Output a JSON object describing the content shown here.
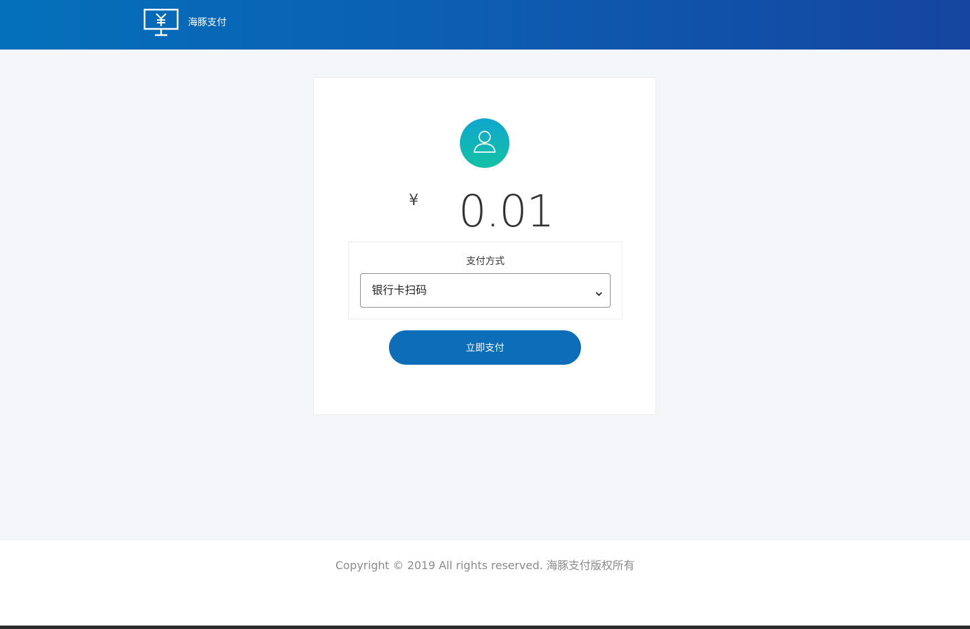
{
  "header": {
    "brand_icon": "monitor-yen-icon",
    "brand_name": "海豚支付",
    "gradient_start": "#0470ba",
    "gradient_end": "#1545a0"
  },
  "payment": {
    "avatar_icon": "user-icon",
    "currency_symbol": "¥",
    "amount": "0.01",
    "method_label": "支付方式",
    "method_selected": "银行卡扫码",
    "submit_label": "立即支付",
    "button_color": "#0d6db8"
  },
  "footer": {
    "copyright": "Copyright © 2019 All rights reserved. 海豚支付版权所有"
  }
}
